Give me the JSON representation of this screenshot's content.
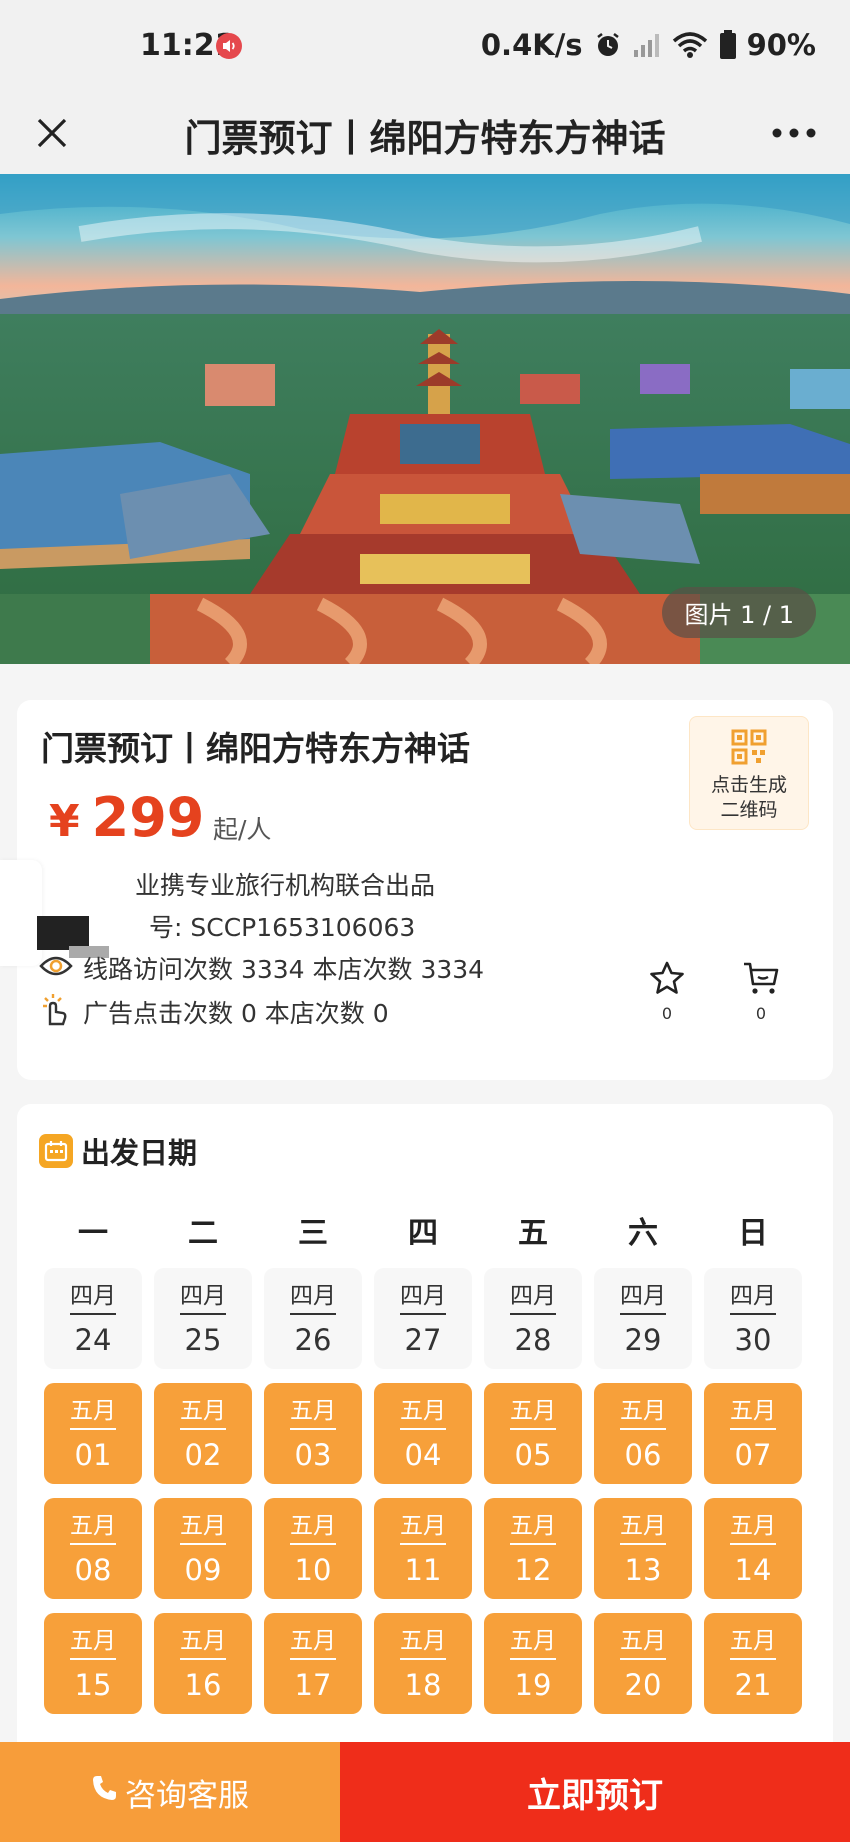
{
  "status_bar": {
    "time": "11:21",
    "net_speed": "0.4K/s",
    "battery": "90%",
    "icons": [
      "mute-icon",
      "alarm-icon",
      "signal-icon",
      "wifi-icon",
      "battery-icon"
    ]
  },
  "nav": {
    "title": "门票预订丨绵阳方特东方神话",
    "close_icon": "close-icon",
    "more_icon": "more-icon"
  },
  "hero": {
    "photo_counter": "图片 1 / 1"
  },
  "product": {
    "title": "门票预订丨绵阳方特东方神话",
    "price_currency": "¥",
    "price": "299",
    "price_unit": "起/人",
    "qr_label_1": "点击生成",
    "qr_label_2": "二维码",
    "line_1": "业携专业旅行机构联合出品",
    "line_2": "号: SCCP1653106063",
    "line_3": "线路访问次数 3334  本店次数 3334",
    "line_4": "广告点击次数 0  本店次数 0",
    "favorite_count": "0",
    "cart_count": "0"
  },
  "calendar": {
    "title": "出发日期",
    "weekdays": [
      "一",
      "二",
      "三",
      "四",
      "五",
      "六",
      "日"
    ],
    "days": [
      {
        "month": "四月",
        "day": "24",
        "status": "past"
      },
      {
        "month": "四月",
        "day": "25",
        "status": "past"
      },
      {
        "month": "四月",
        "day": "26",
        "status": "past"
      },
      {
        "month": "四月",
        "day": "27",
        "status": "past"
      },
      {
        "month": "四月",
        "day": "28",
        "status": "past"
      },
      {
        "month": "四月",
        "day": "29",
        "status": "past"
      },
      {
        "month": "四月",
        "day": "30",
        "status": "past"
      },
      {
        "month": "五月",
        "day": "01",
        "status": "available"
      },
      {
        "month": "五月",
        "day": "02",
        "status": "available"
      },
      {
        "month": "五月",
        "day": "03",
        "status": "available"
      },
      {
        "month": "五月",
        "day": "04",
        "status": "available"
      },
      {
        "month": "五月",
        "day": "05",
        "status": "available"
      },
      {
        "month": "五月",
        "day": "06",
        "status": "available"
      },
      {
        "month": "五月",
        "day": "07",
        "status": "available"
      },
      {
        "month": "五月",
        "day": "08",
        "status": "available"
      },
      {
        "month": "五月",
        "day": "09",
        "status": "available"
      },
      {
        "month": "五月",
        "day": "10",
        "status": "available"
      },
      {
        "month": "五月",
        "day": "11",
        "status": "available"
      },
      {
        "month": "五月",
        "day": "12",
        "status": "available"
      },
      {
        "month": "五月",
        "day": "13",
        "status": "available"
      },
      {
        "month": "五月",
        "day": "14",
        "status": "available"
      },
      {
        "month": "五月",
        "day": "15",
        "status": "available"
      },
      {
        "month": "五月",
        "day": "16",
        "status": "available"
      },
      {
        "month": "五月",
        "day": "17",
        "status": "available"
      },
      {
        "month": "五月",
        "day": "18",
        "status": "available"
      },
      {
        "month": "五月",
        "day": "19",
        "status": "available"
      },
      {
        "month": "五月",
        "day": "20",
        "status": "available"
      },
      {
        "month": "五月",
        "day": "21",
        "status": "available"
      }
    ]
  },
  "bottom_bar": {
    "service_label": "咨询客服",
    "book_label": "立即预订"
  },
  "colors": {
    "price_red": "#e5421e",
    "available_orange": "#f7a03a",
    "book_red": "#ef2d1a",
    "service_orange": "#f79d3a"
  }
}
